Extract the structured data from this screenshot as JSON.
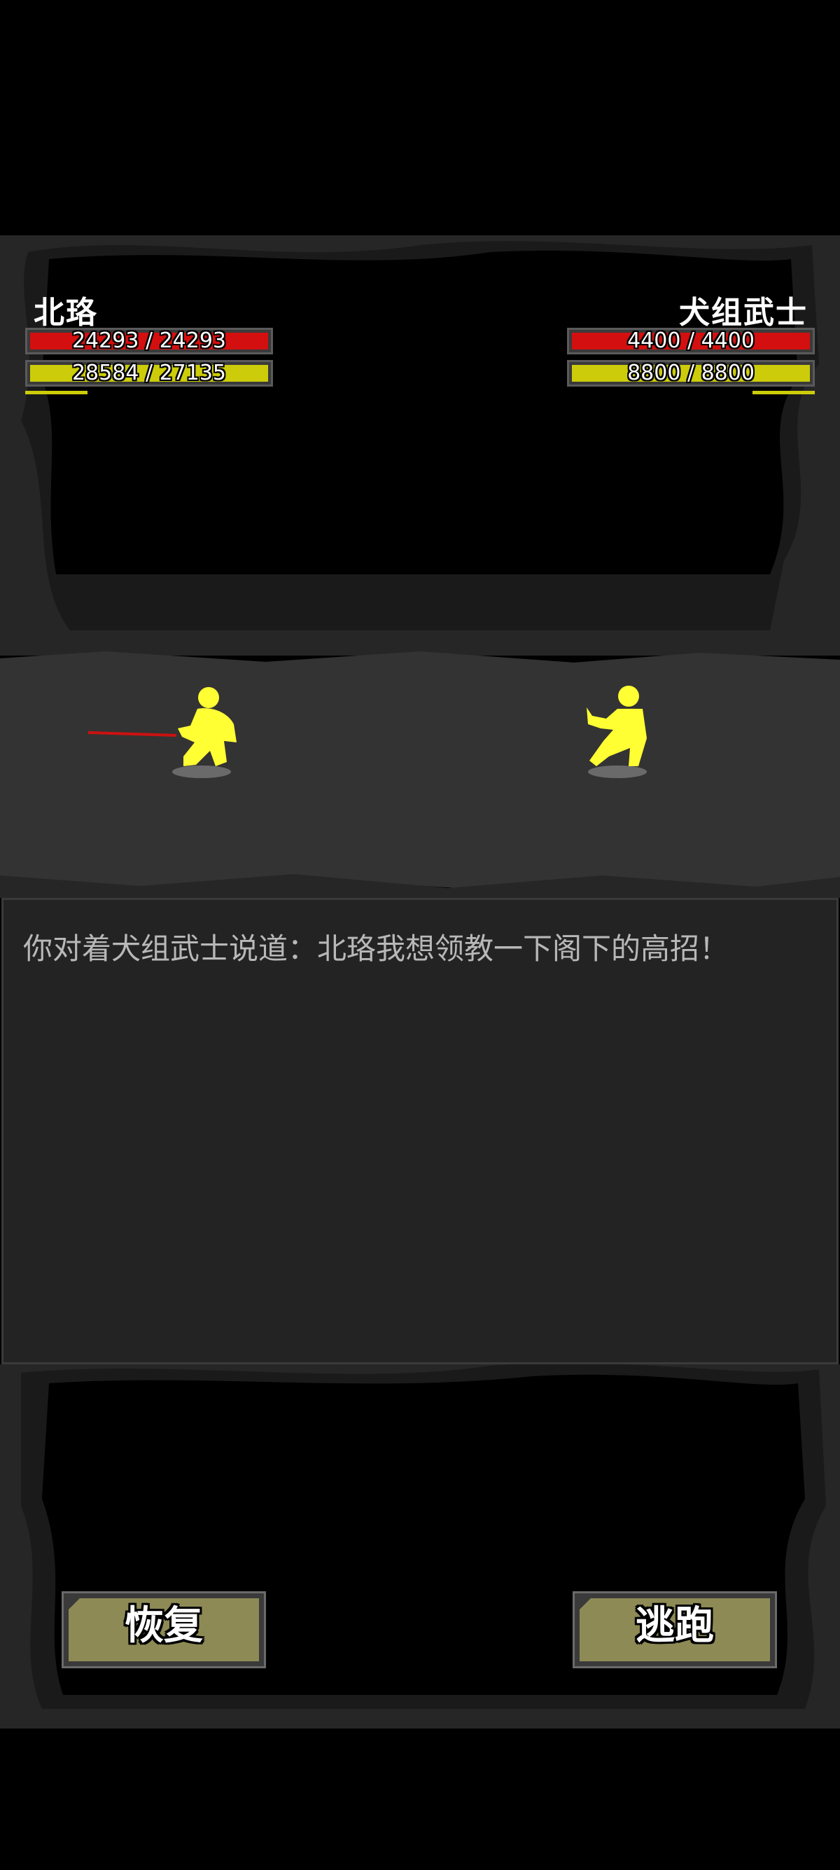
{
  "player": {
    "name": "北珞",
    "hp_text": "24293 / 24293",
    "hp_fraction": 1.0,
    "mp_text": "28584 / 27135",
    "mp_fraction": 1.0,
    "charge_fraction": 0.5
  },
  "enemy": {
    "name": "犬组武士",
    "hp_text": "4400 / 4400",
    "hp_fraction": 1.0,
    "mp_text": "8800 / 8800",
    "mp_fraction": 1.0,
    "charge_fraction": 0.5
  },
  "log": {
    "lines": [
      "你对着犬组武士说道：北珞我想领教一下阁下的高招！"
    ]
  },
  "actions": {
    "recover_label": "恢复",
    "flee_label": "逃跑"
  },
  "colors": {
    "hp": "#d40f0f",
    "mp": "#cccc0a",
    "character": "#ffff33",
    "ground": "#333333",
    "button": "#8d8a55"
  }
}
